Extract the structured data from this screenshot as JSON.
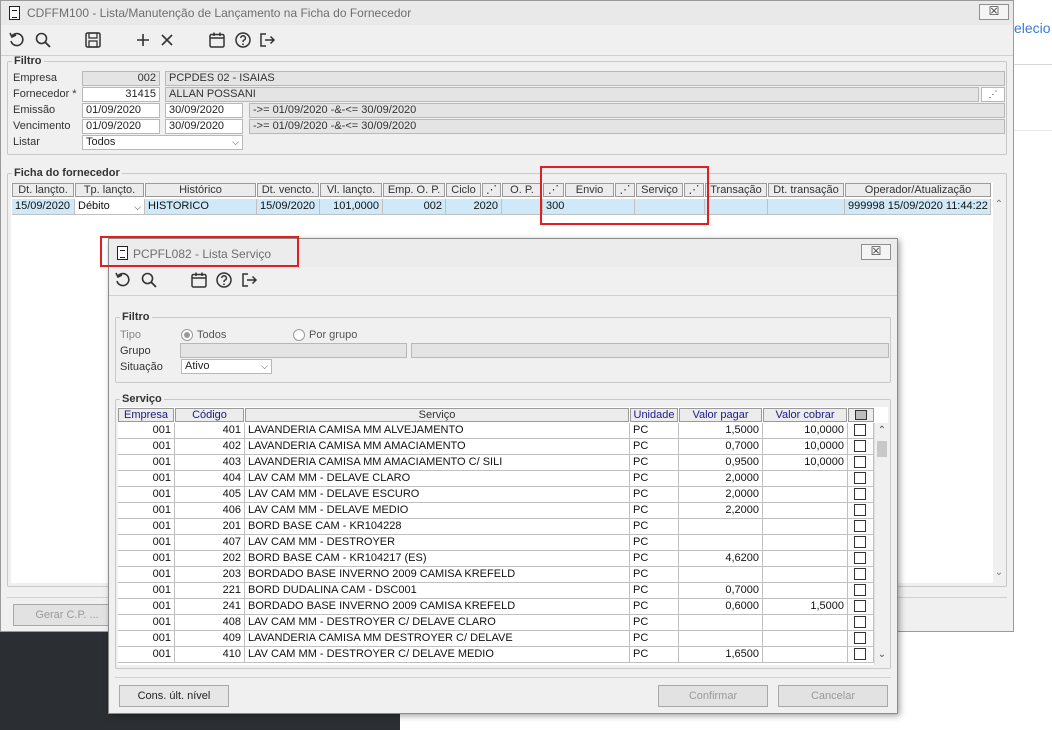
{
  "main": {
    "title": "CDFFM100 - Lista/Manutenção de Lançamento na Ficha do Fornecedor",
    "close_label": "☒",
    "filter": {
      "legend": "Filtro",
      "empresa_label": "Empresa",
      "empresa_code": "002",
      "empresa_name": "PCPDES 02 - ISAIAS",
      "fornecedor_label": "Fornecedor *",
      "fornecedor_code": "31415",
      "fornecedor_name": "ALLAN POSSANI",
      "emissao_label": "Emissão",
      "emissao_from": "01/09/2020",
      "emissao_to": "30/09/2020",
      "emissao_desc": "->= 01/09/2020 -&-<= 30/09/2020",
      "vencimento_label": "Vencimento",
      "vencimento_from": "01/09/2020",
      "vencimento_to": "30/09/2020",
      "vencimento_desc": "->= 01/09/2020 -&-<= 30/09/2020",
      "listar_label": "Listar",
      "listar_value": "Todos"
    },
    "ficha": {
      "legend": "Ficha do fornecedor",
      "headers": [
        "Dt. lançto.",
        "Tp. lançto.",
        "Histórico",
        "Dt. vencto.",
        "Vl. lançto.",
        "Emp. O. P.",
        "Ciclo",
        "",
        "O. P.",
        "",
        "Envio",
        "",
        "Serviço",
        "",
        "Transação",
        "Dt. transação",
        "Operador/Atualização"
      ],
      "row": {
        "dt": "15/09/2020",
        "tipo": "Débito",
        "historico": "HISTORICO",
        "vencto": "15/09/2020",
        "valor": "101,0000",
        "emp": "002",
        "ciclo": "2020",
        "op": "300",
        "operador": "999998",
        "atualizacao": "15/09/2020 11:44:22"
      }
    },
    "gerar_label": "Gerar C.P. ..."
  },
  "popup": {
    "title": "PCPFL082 - Lista Serviço",
    "close_label": "☒",
    "filter": {
      "legend": "Filtro",
      "tipo_label": "Tipo",
      "tipo_todos": "Todos",
      "tipo_grupo": "Por grupo",
      "grupo_label": "Grupo",
      "situacao_label": "Situação",
      "situacao_value": "Ativo"
    },
    "servico": {
      "legend": "Serviço",
      "headers": [
        "Empresa",
        "Código",
        "Serviço",
        "Unidade",
        "Valor pagar",
        "Valor cobrar"
      ],
      "rows": [
        [
          "001",
          "401",
          "LAVANDERIA CAMISA MM ALVEJAMENTO",
          "PC",
          "1,5000",
          "10,0000"
        ],
        [
          "001",
          "402",
          "LAVANDERIA CAMISA MM AMACIAMENTO",
          "PC",
          "0,7000",
          "10,0000"
        ],
        [
          "001",
          "403",
          "LAVANDERIA CAMISA MM AMACIAMENTO C/ SILI",
          "PC",
          "0,9500",
          "10,0000"
        ],
        [
          "001",
          "404",
          "LAV CAM MM - DELAVE CLARO",
          "PC",
          "2,0000",
          ""
        ],
        [
          "001",
          "405",
          "LAV CAM MM - DELAVE ESCURO",
          "PC",
          "2,0000",
          ""
        ],
        [
          "001",
          "406",
          "LAV CAM MM - DELAVE MEDIO",
          "PC",
          "2,2000",
          ""
        ],
        [
          "001",
          "201",
          "BORD BASE CAM - KR104228",
          "PC",
          "",
          ""
        ],
        [
          "001",
          "407",
          "LAV CAM MM - DESTROYER",
          "PC",
          "",
          ""
        ],
        [
          "001",
          "202",
          "BORD BASE CAM - KR104217 (ES)",
          "PC",
          "4,6200",
          ""
        ],
        [
          "001",
          "203",
          "BORDADO BASE INVERNO 2009 CAMISA KREFELD",
          "PC",
          "",
          ""
        ],
        [
          "001",
          "221",
          "BORD DUDALINA CAM - DSC001",
          "PC",
          "0,7000",
          ""
        ],
        [
          "001",
          "241",
          "BORDADO BASE INVERNO 2009 CAMISA KREFELD",
          "PC",
          "0,6000",
          "1,5000"
        ],
        [
          "001",
          "408",
          "LAV CAM MM - DESTROYER C/ DELAVE CLARO",
          "PC",
          "",
          ""
        ],
        [
          "001",
          "409",
          "LAVANDERIA CAMISA MM DESTROYER C/ DELAVE",
          "PC",
          "",
          ""
        ],
        [
          "001",
          "410",
          "LAV CAM MM - DESTROYER C/ DELAVE MEDIO",
          "PC",
          "1,6500",
          ""
        ]
      ]
    },
    "cons_label": "Cons. últ. nível",
    "confirmar_label": "Confirmar",
    "cancelar_label": "Cancelar"
  },
  "background": {
    "peek_text": "elecio"
  },
  "icons": {
    "refresh": "refresh-icon",
    "search": "search-icon",
    "save": "save-icon",
    "add": "plus-icon",
    "delete": "x-icon",
    "calendar": "calendar-icon",
    "help": "help-icon",
    "exit": "exit-icon"
  }
}
